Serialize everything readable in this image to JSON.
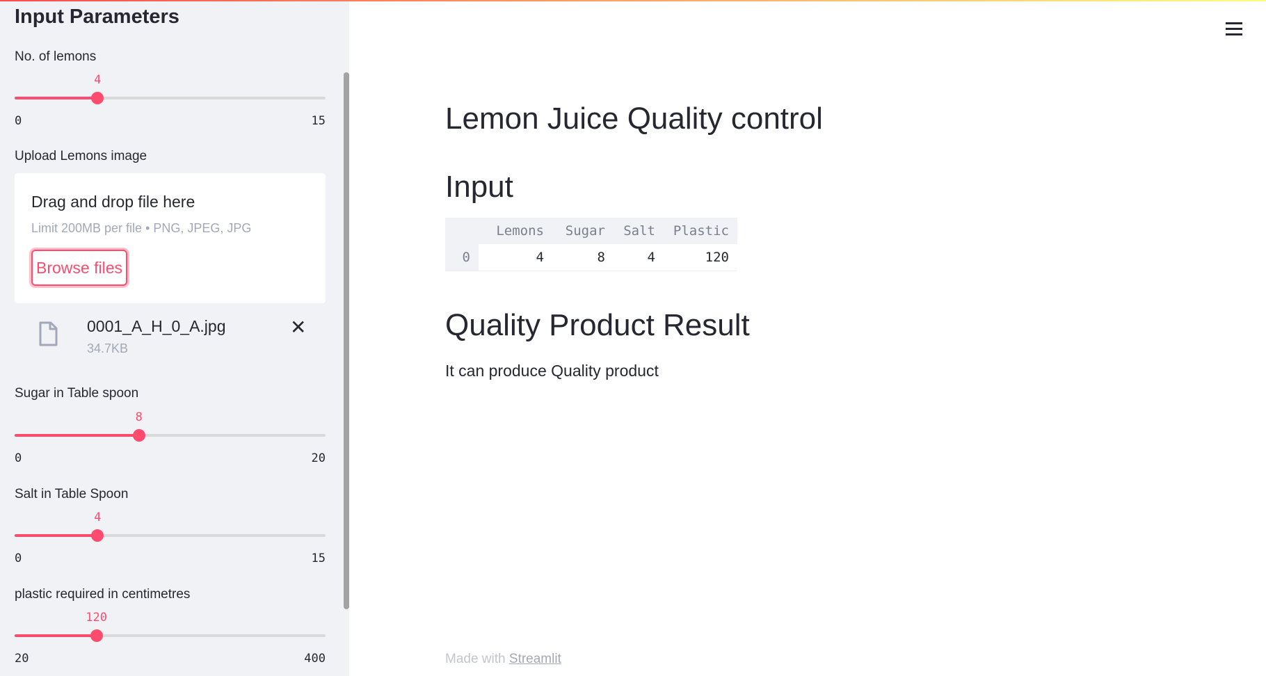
{
  "colors": {
    "accent": "#ff4b6e",
    "sidebar_bg": "#f0f2f6",
    "text": "#262730",
    "muted": "#a3a8b8"
  },
  "sidebar": {
    "title": "Input Parameters",
    "sliders": [
      {
        "label": "No. of lemons",
        "value": "4",
        "min": "0",
        "max": "15",
        "fraction": 0.2667
      },
      {
        "label": "Sugar in Table spoon",
        "value": "8",
        "min": "0",
        "max": "20",
        "fraction": 0.4
      },
      {
        "label": "Salt in Table Spoon",
        "value": "4",
        "min": "0",
        "max": "15",
        "fraction": 0.2667
      },
      {
        "label": "plastic required in centimetres",
        "value": "120",
        "min": "20",
        "max": "400",
        "fraction": 0.2632
      }
    ],
    "uploader": {
      "label": "Upload Lemons image",
      "title": "Drag and drop file here",
      "subtitle": "Limit 200MB per file • PNG, JPEG, JPG",
      "button": "Browse files",
      "file": {
        "name": "0001_A_H_0_A.jpg",
        "size": "34.7KB",
        "icon": "file-icon",
        "close_icon": "close-icon"
      }
    }
  },
  "header": {
    "menu_icon": "hamburger-menu-icon"
  },
  "main": {
    "title": "Lemon Juice Quality control",
    "input_heading": "Input",
    "table": {
      "columns": [
        "",
        "Lemons",
        "Sugar",
        "Salt",
        "Plastic"
      ],
      "rows": [
        [
          "0",
          "4",
          "8",
          "4",
          "120"
        ]
      ]
    },
    "result_heading": "Quality Product Result",
    "result_text": "It can produce Quality product"
  },
  "footer": {
    "made_with": "Made with",
    "link": "Streamlit"
  }
}
